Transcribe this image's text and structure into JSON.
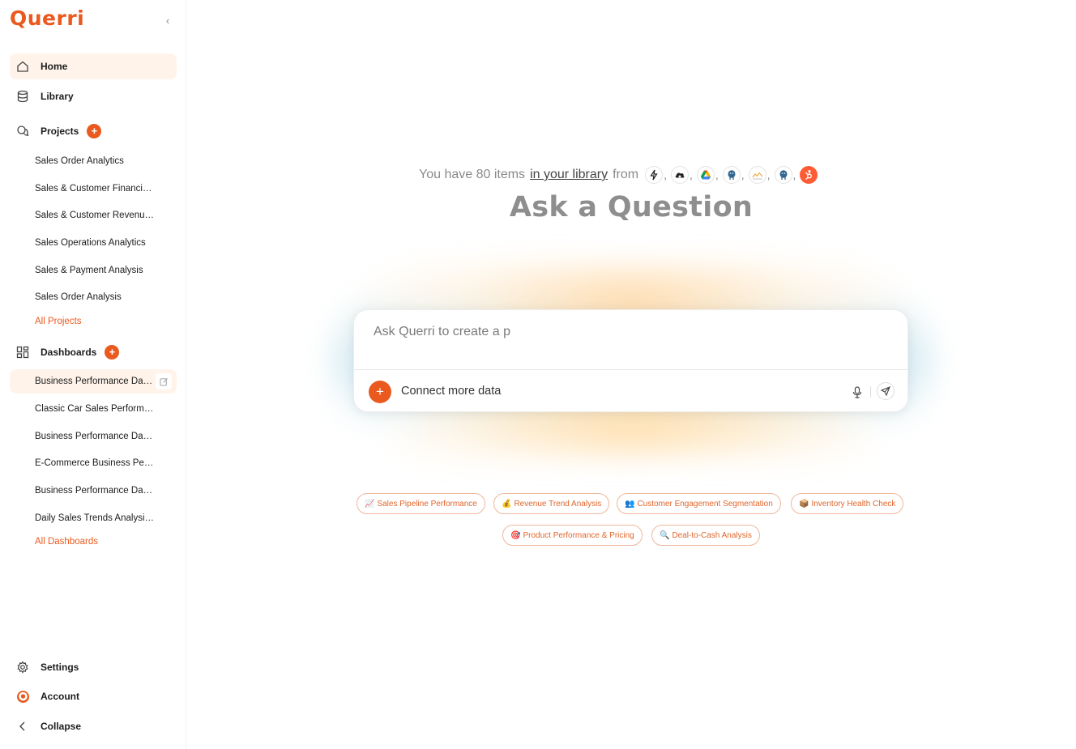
{
  "brand": {
    "logo_text": "Querri",
    "accent": "#ea5a1e"
  },
  "sidebar": {
    "home": "Home",
    "library": "Library",
    "projects": {
      "label": "Projects",
      "items": [
        "Sales Order Analytics",
        "Sales & Customer Financia…",
        "Sales & Customer Revenue…",
        "Sales Operations Analytics",
        "Sales & Payment Analysis",
        "Sales Order Analysis"
      ],
      "all_link": "All Projects"
    },
    "dashboards": {
      "label": "Dashboards",
      "items": [
        "Business Performance Das…",
        "Classic Car Sales Performa…",
        "Business Performance Das…",
        "E-Commerce Business Perf…",
        "Business Performance Das…",
        "Daily Sales Trends Analysi…"
      ],
      "all_link": "All Dashboards"
    },
    "settings": "Settings",
    "account": "Account",
    "collapse": "Collapse"
  },
  "main": {
    "library_prefix": "You have 80 items",
    "library_link": "in your library",
    "library_from": "from",
    "source_icons": [
      "lightning-icon",
      "cloud-upload-icon",
      "google-drive-icon",
      "postgres-icon",
      "chart-source-icon",
      "postgres-icon",
      "hubspot-icon"
    ],
    "title": "Ask a Question",
    "ask_placeholder": "Ask Querri to create a p",
    "connect_label": "Connect more data",
    "chips_row1": [
      {
        "emoji": "📈",
        "label": "Sales Pipeline Performance"
      },
      {
        "emoji": "💰",
        "label": "Revenue Trend Analysis"
      },
      {
        "emoji": "👥",
        "label": "Customer Engagement Segmentation"
      },
      {
        "emoji": "📦",
        "label": "Inventory Health Check"
      }
    ],
    "chips_row2": [
      {
        "emoji": "🎯",
        "label": "Product Performance & Pricing"
      },
      {
        "emoji": "🔍",
        "label": "Deal-to-Cash Analysis"
      }
    ]
  }
}
